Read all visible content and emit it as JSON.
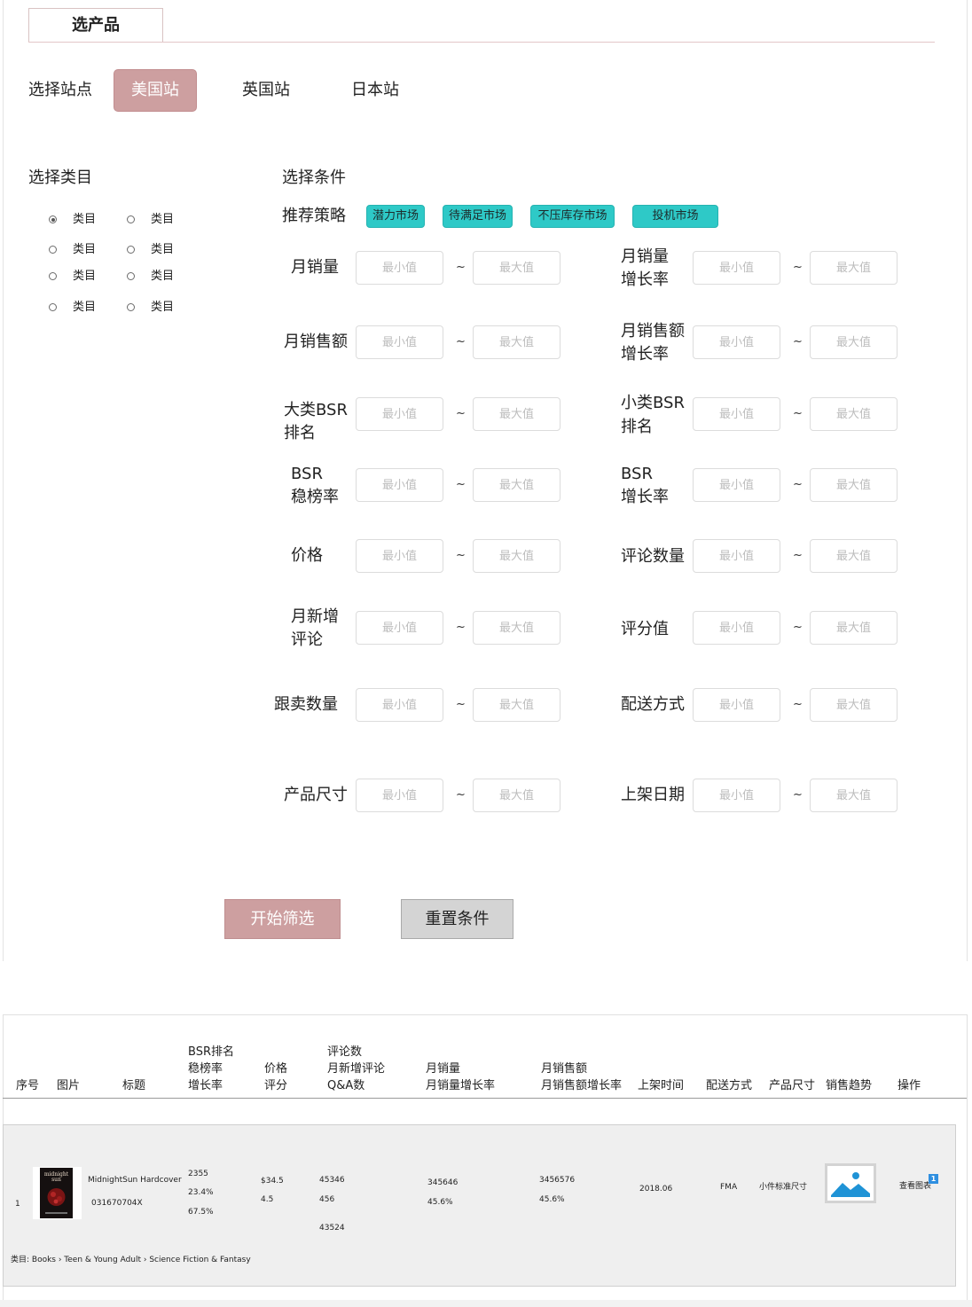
{
  "tab": {
    "label": "选产品"
  },
  "site": {
    "label": "选择站点",
    "options": [
      "美国站",
      "英国站",
      "日本站"
    ],
    "selected": "美国站"
  },
  "category": {
    "label": "选择类目",
    "items": [
      "类目",
      "类目",
      "类目",
      "类目",
      "类目",
      "类目",
      "类目",
      "类目"
    ],
    "selected_index": 0
  },
  "conditions": {
    "label": "选择条件",
    "strategy_label": "推荐策略",
    "strategies": [
      "潜力市场",
      "待满足市场",
      "不压库存市场",
      "投机市场"
    ],
    "min_placeholder": "最小值",
    "max_placeholder": "最大值",
    "separator": "~",
    "left": [
      {
        "line1": "月销量",
        "line2": ""
      },
      {
        "line1": "月销售额",
        "line2": ""
      },
      {
        "line1": "大类BSR",
        "line2": "排名"
      },
      {
        "line1": "BSR",
        "line2": "稳榜率"
      },
      {
        "line1": "价格",
        "line2": ""
      },
      {
        "line1": "月新增",
        "line2": "评论"
      },
      {
        "line1": "跟卖数量",
        "line2": ""
      },
      {
        "line1": "产品尺寸",
        "line2": ""
      }
    ],
    "right": [
      {
        "line1": "月销量",
        "line2": "增长率"
      },
      {
        "line1": "月销售额",
        "line2": "增长率"
      },
      {
        "line1": "小类BSR",
        "line2": "排名"
      },
      {
        "line1": "BSR",
        "line2": "增长率"
      },
      {
        "line1": "评论数量",
        "line2": ""
      },
      {
        "line1": "评分值",
        "line2": ""
      },
      {
        "line1": "配送方式",
        "line2": ""
      },
      {
        "line1": "上架日期",
        "line2": ""
      }
    ]
  },
  "actions": {
    "start": "开始筛选",
    "reset": "重置条件"
  },
  "table": {
    "headers": {
      "index": "序号",
      "image": "图片",
      "title": "标题",
      "bsr": [
        "BSR排名",
        "稳榜率",
        "增长率"
      ],
      "price": [
        "价格",
        "评分"
      ],
      "reviews": [
        "评论数",
        "月新增评论",
        "Q&A数"
      ],
      "sales": [
        "月销量",
        "月销量增长率"
      ],
      "revenue": [
        "月销售额",
        "月销售额增长率"
      ],
      "listed": "上架时间",
      "delivery": "配送方式",
      "size": "产品尺寸",
      "trend": "销售趋势",
      "action": "操作"
    },
    "row": {
      "index": "1",
      "title": "MidnightSun Hardcover",
      "asin": "031670704X",
      "bsr": [
        "2355",
        "23.4%",
        "67.5%"
      ],
      "price": "$34.5",
      "rating": "4.5",
      "reviews": [
        "45346",
        "456",
        "43524"
      ],
      "sales": [
        "345646",
        "45.6%"
      ],
      "revenue": [
        "3456576",
        "45.6%"
      ],
      "listed": "2018.06",
      "delivery": "FMA",
      "size": "小件标准尺寸",
      "action": "查看图表",
      "badge": "1",
      "category_path": "类目:   Books › Teen & Young Adult › Science Fiction & Fantasy"
    }
  },
  "colors": {
    "accent": "#cd9fa0",
    "strategy": "#2ec9c7",
    "reset": "#d4d4d4"
  }
}
